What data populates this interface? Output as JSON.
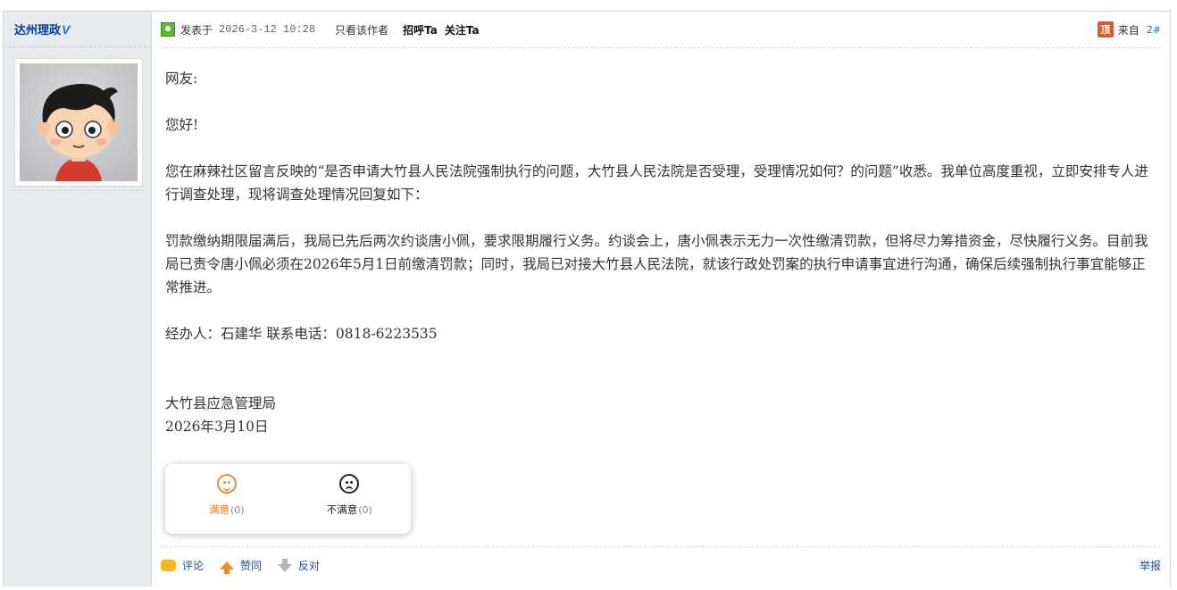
{
  "author": {
    "name": "达州理政",
    "badge": "V"
  },
  "meta": {
    "posted_label": "发表于",
    "date": "2026-3-12 10:28",
    "only_author": "只看该作者",
    "greet": "招呼Ta",
    "follow": "关注Ta",
    "top_badge": "顶",
    "from": "来自",
    "floor": "2#"
  },
  "content": {
    "greeting": "网友:",
    "hello": "您好!",
    "para1": "您在麻辣社区留言反映的“是否申请大竹县人民法院强制执行的问题，大竹县人民法院是否受理，受理情况如何？的问题”收悉。我单位高度重视，立即安排专人进行调查处理，现将调查处理情况回复如下：",
    "para2": "罚款缴纳期限届满后，我局已先后两次约谈唐小佩，要求限期履行义务。约谈会上，唐小佩表示无力一次性缴清罚款，但将尽力筹措资金，尽快履行义务。目前我局已责令唐小佩必须在2026年5月1日前缴清罚款；同时，我局已对接大竹县人民法院，就该行政处罚案的执行申请事宜进行沟通，确保后续强制执行事宜能够正常推进。",
    "contact": "经办人：石建华 联系电话：0818-6223535",
    "org": "大竹县应急管理局",
    "date": "2026年3月10日"
  },
  "vote": {
    "satisfied_label": "满意",
    "satisfied_count": "(0)",
    "unsatisfied_label": "不满意",
    "unsatisfied_count": "(0)"
  },
  "actions": {
    "comment": "评论",
    "agree": "赞同",
    "oppose": "反对",
    "report": "举报"
  }
}
